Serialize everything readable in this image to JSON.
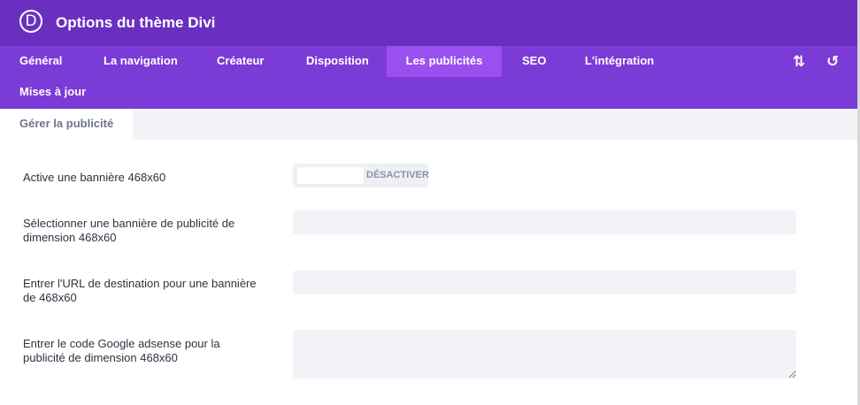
{
  "header": {
    "logo_letter": "D",
    "title": "Options du thème Divi"
  },
  "nav": {
    "tabs": [
      {
        "label": "Général",
        "active": false
      },
      {
        "label": "La navigation",
        "active": false
      },
      {
        "label": "Créateur",
        "active": false
      },
      {
        "label": "Disposition",
        "active": false
      },
      {
        "label": "Les publicités",
        "active": true
      },
      {
        "label": "SEO",
        "active": false
      },
      {
        "label": "L'intégration",
        "active": false
      },
      {
        "label": "Mises à jour",
        "active": false
      }
    ],
    "icons": {
      "sort": "sort-arrows-icon",
      "reset": "undo-icon"
    }
  },
  "subnav": {
    "tabs": [
      {
        "label": "Gérer la publicité",
        "active": true
      }
    ]
  },
  "settings": {
    "banner_toggle": {
      "label": "Active une bannière 468x60",
      "state_label": "DÉSACTIVER",
      "enabled": false
    },
    "banner_image": {
      "label": "Sélectionner une bannière de publicité de dimension 468x60",
      "value": ""
    },
    "banner_url": {
      "label": "Entrer l'URL de destination pour une bannière de 468x60",
      "value": ""
    },
    "adsense_code": {
      "label": "Entrer le code Google adsense pour la publicité de dimension 468x60",
      "value": ""
    }
  },
  "colors": {
    "header_bg": "#6b2fc0",
    "nav_bg": "#7b3bd6",
    "active_tab_bg": "#9a4ff0",
    "field_bg": "#f1f3f7"
  }
}
